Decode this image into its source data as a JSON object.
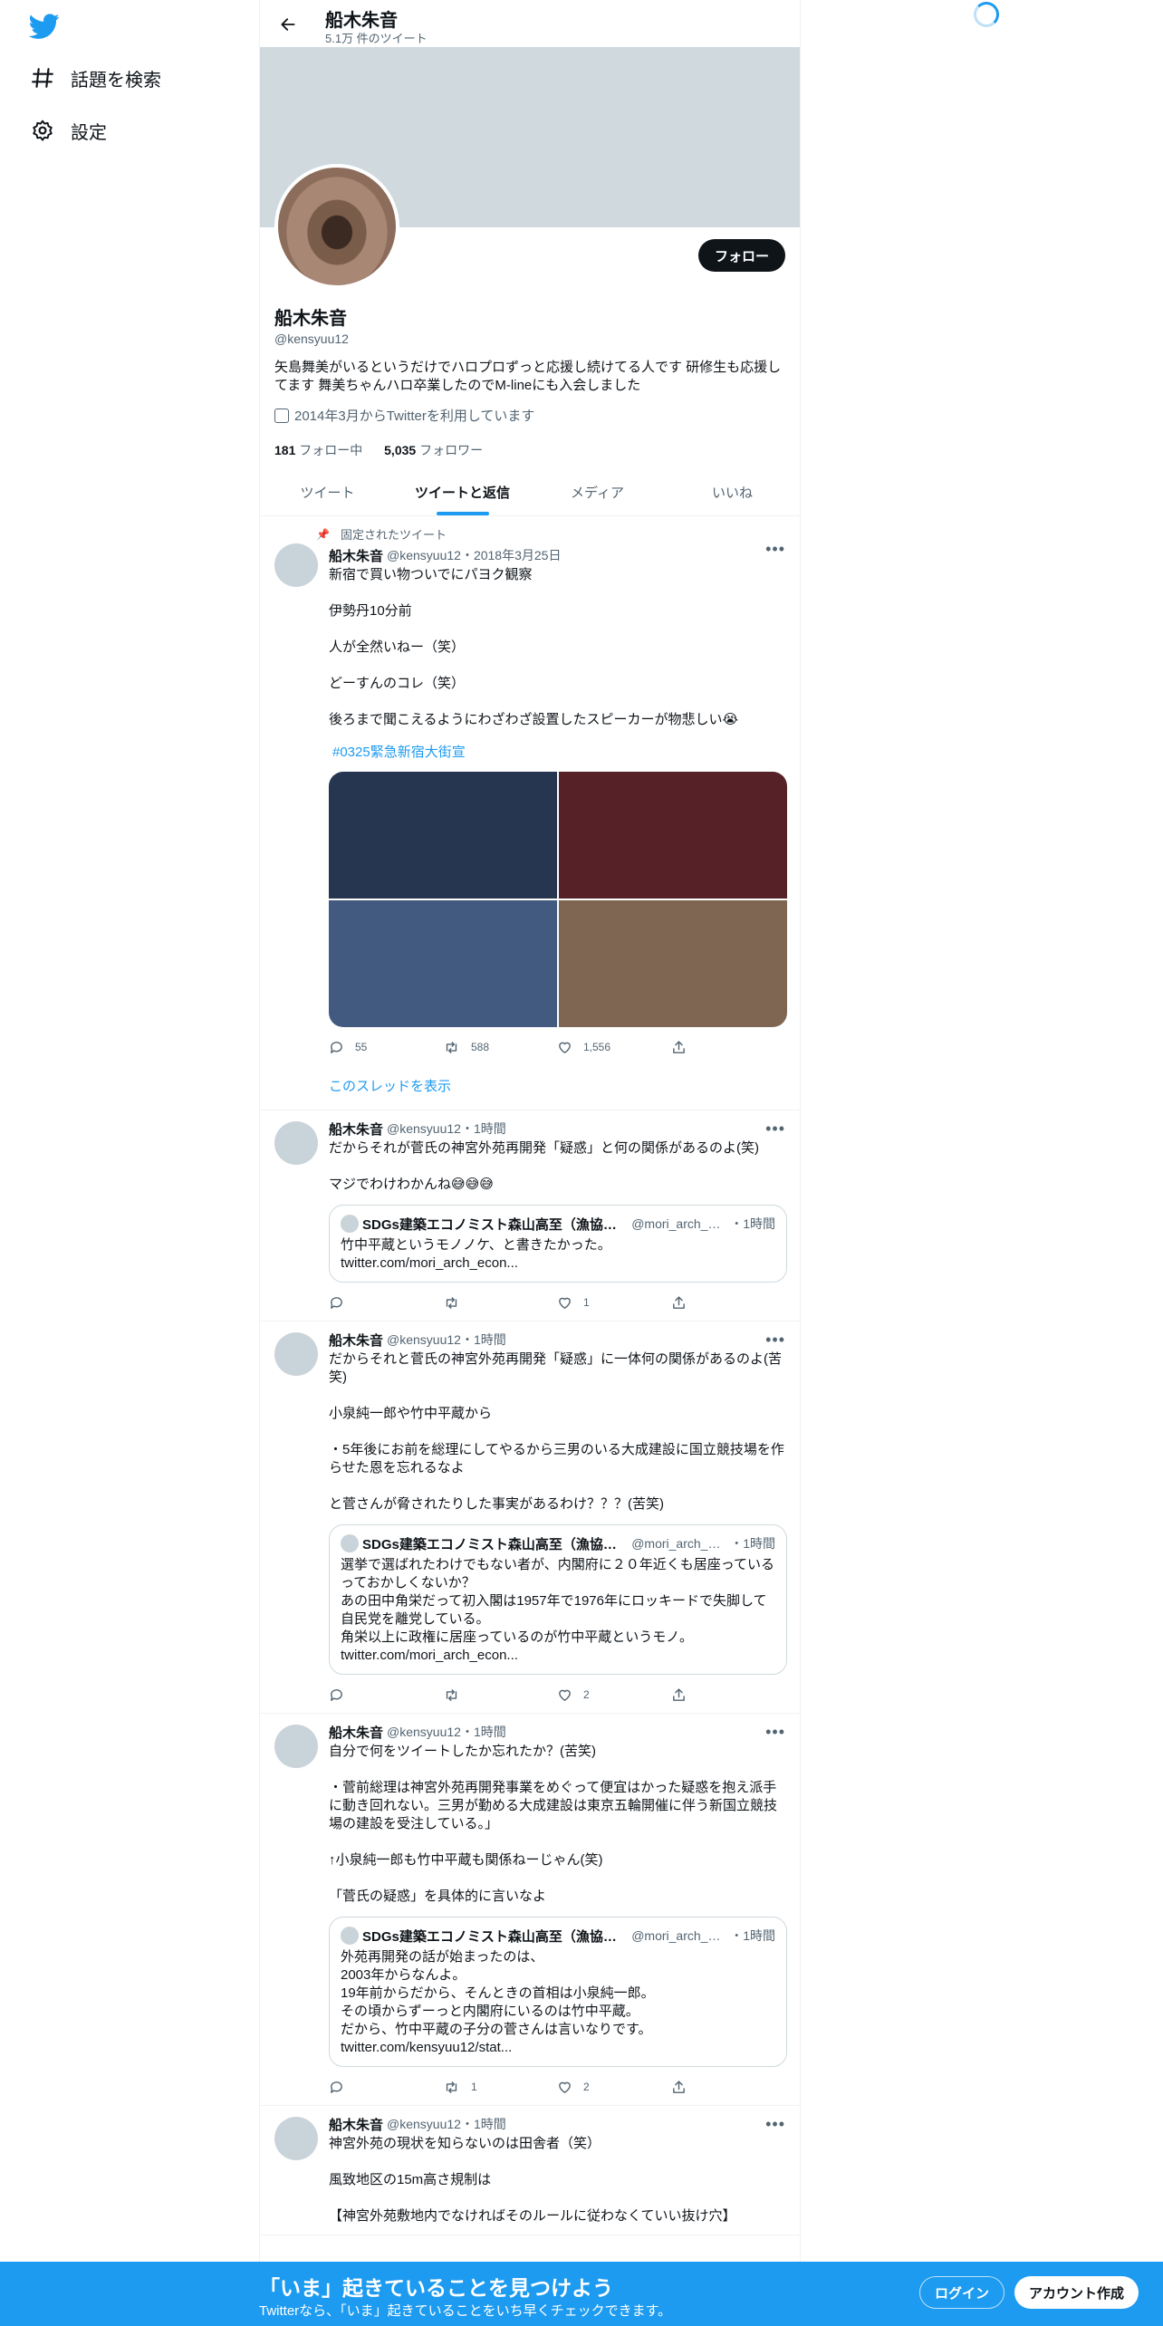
{
  "colors": {
    "accent": "#1d9bf0",
    "text": "#0f1419",
    "muted": "#536471"
  },
  "nav": {
    "logo": "twitter-bird-icon",
    "items": [
      {
        "label": "話題を検索",
        "icon": "hashtag-icon"
      },
      {
        "label": "設定",
        "icon": "gear-icon"
      }
    ]
  },
  "header": {
    "name": "船木朱音",
    "tweet_count": "5.1万 件のツイート"
  },
  "profile": {
    "name": "船木朱音",
    "handle": "@kensyuu12",
    "bio": "矢島舞美がいるというだけでハロプロずっと応援し続けてる人です 研修生も応援してます 舞美ちゃんハロ卒業したのでM-lineにも入会しました",
    "joined": "2014年3月からTwitterを利用しています",
    "following_count": "181",
    "following_label": "フォロー中",
    "followers_count": "5,035",
    "followers_label": "フォロワー",
    "follow_button": "フォロー"
  },
  "tabs": [
    "ツイート",
    "ツイートと返信",
    "メディア",
    "いいね"
  ],
  "tweets": [
    {
      "pinned_label": "固定されたツイート",
      "name": "船木朱音",
      "meta": "@kensyuu12・2018年3月25日",
      "text": "新宿で買い物ついでにパヨク観察\n\n伊勢丹10分前\n\n人が全然いねー（笑）\n\nどーすんのコレ（笑）\n\n後ろまで聞こえるようにわざわざ設置したスピーカーが物悲しい😭",
      "hashtag": "#0325緊急新宿大街宣",
      "media_colors": [
        "#263550",
        "#562228",
        "#425a80",
        "#7e6652"
      ],
      "replies": "55",
      "retweets": "588",
      "likes": "1,556",
      "thread_link": "このスレッドを表示"
    },
    {
      "name": "船木朱音",
      "meta": "@kensyuu12・1時間",
      "text": "だからそれが菅氏の神宮外苑再開発「疑惑」と何の関係があるのよ(笑)\n\nマジでわけわかんね😅😅😅",
      "quote": {
        "name": "SDGs建築エコノミスト森山高至（漁協建築家）",
        "handle": "@mori_arch_econo",
        "time": "・1時間",
        "text": "竹中平蔵というモノノケ、と書きたかった。\ntwitter.com/mori_arch_econ..."
      },
      "replies": "",
      "retweets": "",
      "likes": "1"
    },
    {
      "name": "船木朱音",
      "meta": "@kensyuu12・1時間",
      "text": "だからそれと菅氏の神宮外苑再開発「疑惑」に一体何の関係があるのよ(苦笑)\n\n小泉純一郎や竹中平蔵から\n\n・5年後にお前を総理にしてやるから三男のいる大成建設に国立競技場を作らせた恩を忘れるなよ\n\nと菅さんが脅されたりした事実があるわけ？？？(苦笑)",
      "quote": {
        "name": "SDGs建築エコノミスト森山高至（漁協建築家）",
        "handle": "@mori_arch_econo",
        "time": "・1時間",
        "text": "選挙で選ばれたわけでもない者が、内閣府に２０年近くも居座っているっておかしくないか？\nあの田中角栄だって初入閣は1957年で1976年にロッキードで失脚して自民党を離党している。\n角栄以上に政権に居座っているのが竹中平蔵というモノ。\ntwitter.com/mori_arch_econ..."
      },
      "replies": "",
      "retweets": "",
      "likes": "2"
    },
    {
      "name": "船木朱音",
      "meta": "@kensyuu12・1時間",
      "text": "自分で何をツイートしたか忘れたか？(苦笑)\n\n・菅前総理は神宮外苑再開発事業をめぐって便宜はかった疑惑を抱え派手に動き回れない。三男が勤める大成建設は東京五輪開催に伴う新国立競技場の建設を受注している。」\n\n↑小泉純一郎も竹中平蔵も関係ねーじゃん(笑)\n\n「菅氏の疑惑」を具体的に言いなよ",
      "quote": {
        "name": "SDGs建築エコノミスト森山高至（漁協建築家）",
        "handle": "@mori_arch_econo",
        "time": "・1時間",
        "text": "外苑再開発の話が始まったのは、\n2003年からなんよ。\n19年前からだから、そんときの首相は小泉純一郎。\nその頃からずーっと内閣府にいるのは竹中平蔵。\nだから、竹中平蔵の子分の菅さんは言いなりです。\ntwitter.com/kensyuu12/stat..."
      },
      "replies": "",
      "retweets": "1",
      "likes": "2"
    },
    {
      "name": "船木朱音",
      "meta": "@kensyuu12・1時間",
      "text": "神宮外苑の現状を知らないのは田舎者（笑）\n\n風致地区の15m高さ規制は\n\n【神宮外苑敷地内でなければそのルールに従わなくていい抜け穴】"
    }
  ],
  "bottom_bar": {
    "title": "「いま」起きていることを見つけよう",
    "subtitle": "Twitterなら、「いま」起きていることをいち早くチェックできます。",
    "login": "ログイン",
    "signup": "アカウント作成"
  }
}
